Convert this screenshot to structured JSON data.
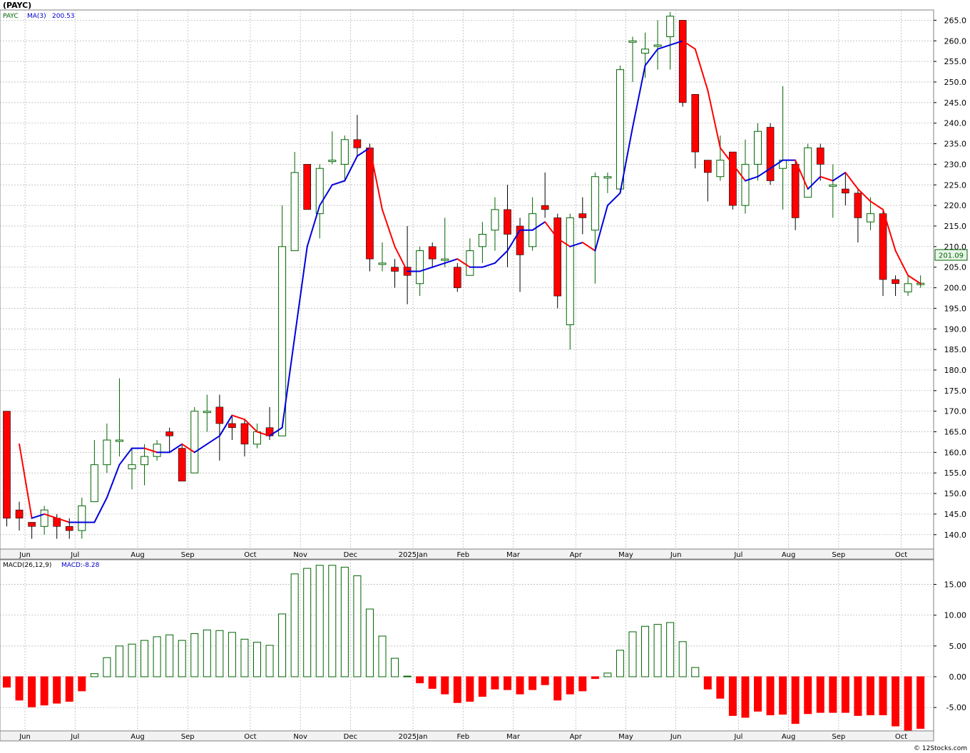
{
  "title": "(PAYC)",
  "credit": "© 12Stocks.com",
  "last_price_label": "201.09",
  "colors": {
    "up": "#006400",
    "down": "#ff0000",
    "ma_up": "#0000dd",
    "ma_down": "#ff0000",
    "grid": "#b0b0b0",
    "axis_bg": "#f2f2f2"
  },
  "legend": {
    "symbol": "PAYC",
    "ma_label": "MA(3)",
    "ma_value": "200.53",
    "macd_label": "MACD(26,12,9)",
    "macd_value": "MACD:-8.28"
  },
  "chart_data": {
    "type": "candlestick",
    "price_axis": {
      "ylim": [
        136.5,
        267.5
      ],
      "ticks": [
        140,
        145,
        150,
        155,
        160,
        165,
        170,
        175,
        180,
        185,
        190,
        195,
        200,
        205,
        210,
        215,
        220,
        225,
        230,
        235,
        240,
        245,
        250,
        255,
        260,
        265
      ]
    },
    "macd_axis": {
      "ylim": [
        -8.8,
        19.0
      ],
      "ticks": [
        "-5.00",
        "0.00",
        "5.00",
        "10.00",
        "15.00"
      ]
    },
    "month_labels": [
      "Jun",
      "Jul",
      "Aug",
      "Sep",
      "Oct",
      "Nov",
      "Dec",
      "2025Jan",
      "Feb",
      "Mar",
      "Apr",
      "May",
      "Jun",
      "Jul",
      "Aug",
      "Sep",
      "Oct"
    ],
    "month_label_week": [
      1,
      5,
      10,
      14,
      19,
      23,
      27,
      32,
      36,
      40,
      45,
      49,
      53,
      58,
      62,
      66,
      71
    ],
    "candles": [
      {
        "o": 170,
        "h": 170,
        "l": 142,
        "c": 144
      },
      {
        "o": 146,
        "h": 148,
        "l": 141,
        "c": 144
      },
      {
        "o": 143,
        "h": 143,
        "l": 139,
        "c": 142
      },
      {
        "o": 142,
        "h": 147,
        "l": 140,
        "c": 146
      },
      {
        "o": 144,
        "h": 145,
        "l": 139,
        "c": 142
      },
      {
        "o": 142,
        "h": 144,
        "l": 139,
        "c": 141
      },
      {
        "o": 141,
        "h": 149,
        "l": 139,
        "c": 147
      },
      {
        "o": 148,
        "h": 163,
        "l": 148,
        "c": 157
      },
      {
        "o": 157,
        "h": 167,
        "l": 155,
        "c": 163
      },
      {
        "o": 163,
        "h": 178,
        "l": 159,
        "c": 163
      },
      {
        "o": 156,
        "h": 161,
        "l": 151,
        "c": 157
      },
      {
        "o": 157,
        "h": 162,
        "l": 152,
        "c": 159
      },
      {
        "o": 159,
        "h": 163,
        "l": 158,
        "c": 162
      },
      {
        "o": 165,
        "h": 166,
        "l": 160,
        "c": 164
      },
      {
        "o": 161,
        "h": 162,
        "l": 153,
        "c": 153
      },
      {
        "o": 155,
        "h": 171,
        "l": 155,
        "c": 170
      },
      {
        "o": 170,
        "h": 174,
        "l": 165,
        "c": 170
      },
      {
        "o": 171,
        "h": 174,
        "l": 158,
        "c": 167
      },
      {
        "o": 167,
        "h": 169,
        "l": 163,
        "c": 166
      },
      {
        "o": 167,
        "h": 168,
        "l": 159,
        "c": 162
      },
      {
        "o": 162,
        "h": 167,
        "l": 161,
        "c": 165
      },
      {
        "o": 166,
        "h": 171,
        "l": 163,
        "c": 164
      },
      {
        "o": 164,
        "h": 220,
        "l": 164,
        "c": 210
      },
      {
        "o": 209,
        "h": 233,
        "l": 209,
        "c": 228
      },
      {
        "o": 230,
        "h": 230,
        "l": 219,
        "c": 219
      },
      {
        "o": 218,
        "h": 230,
        "l": 212,
        "c": 229
      },
      {
        "o": 231,
        "h": 238,
        "l": 230,
        "c": 231
      },
      {
        "o": 230,
        "h": 237,
        "l": 226,
        "c": 236
      },
      {
        "o": 236,
        "h": 242,
        "l": 232,
        "c": 234
      },
      {
        "o": 234,
        "h": 235,
        "l": 204,
        "c": 207
      },
      {
        "o": 206,
        "h": 211,
        "l": 204,
        "c": 206
      },
      {
        "o": 205,
        "h": 207,
        "l": 200,
        "c": 204
      },
      {
        "o": 205,
        "h": 215,
        "l": 196,
        "c": 203
      },
      {
        "o": 201,
        "h": 210,
        "l": 198,
        "c": 209
      },
      {
        "o": 210,
        "h": 211,
        "l": 205,
        "c": 207
      },
      {
        "o": 207,
        "h": 217,
        "l": 205,
        "c": 207
      },
      {
        "o": 205,
        "h": 206,
        "l": 199,
        "c": 200
      },
      {
        "o": 203,
        "h": 212,
        "l": 203,
        "c": 209
      },
      {
        "o": 210,
        "h": 216,
        "l": 206,
        "c": 213
      },
      {
        "o": 214,
        "h": 222,
        "l": 209,
        "c": 219
      },
      {
        "o": 219,
        "h": 225,
        "l": 205,
        "c": 213
      },
      {
        "o": 215,
        "h": 217,
        "l": 199,
        "c": 208
      },
      {
        "o": 210,
        "h": 222,
        "l": 209,
        "c": 218
      },
      {
        "o": 220,
        "h": 228,
        "l": 217,
        "c": 219
      },
      {
        "o": 217,
        "h": 218,
        "l": 195,
        "c": 198
      },
      {
        "o": 191,
        "h": 218,
        "l": 185,
        "c": 217
      },
      {
        "o": 218,
        "h": 222,
        "l": 213,
        "c": 217
      },
      {
        "o": 214,
        "h": 228,
        "l": 201,
        "c": 227
      },
      {
        "o": 227,
        "h": 228,
        "l": 223,
        "c": 227
      },
      {
        "o": 224,
        "h": 254,
        "l": 223,
        "c": 253
      },
      {
        "o": 260,
        "h": 261,
        "l": 250,
        "c": 260
      },
      {
        "o": 257,
        "h": 262,
        "l": 251,
        "c": 258
      },
      {
        "o": 259,
        "h": 265,
        "l": 253,
        "c": 259
      },
      {
        "o": 261,
        "h": 267,
        "l": 253,
        "c": 266
      },
      {
        "o": 265,
        "h": 265,
        "l": 244,
        "c": 245
      },
      {
        "o": 247,
        "h": 247,
        "l": 229,
        "c": 233
      },
      {
        "o": 231,
        "h": 231,
        "l": 221,
        "c": 228
      },
      {
        "o": 227,
        "h": 237,
        "l": 226,
        "c": 231
      },
      {
        "o": 233,
        "h": 233,
        "l": 219,
        "c": 220
      },
      {
        "o": 220,
        "h": 236,
        "l": 218,
        "c": 230
      },
      {
        "o": 230,
        "h": 240,
        "l": 226,
        "c": 238
      },
      {
        "o": 239,
        "h": 240,
        "l": 225,
        "c": 226
      },
      {
        "o": 229,
        "h": 249,
        "l": 219,
        "c": 231
      },
      {
        "o": 230,
        "h": 231,
        "l": 214,
        "c": 217
      },
      {
        "o": 222,
        "h": 235,
        "l": 222,
        "c": 234
      },
      {
        "o": 234,
        "h": 235,
        "l": 226,
        "c": 230
      },
      {
        "o": 225,
        "h": 230,
        "l": 217,
        "c": 225
      },
      {
        "o": 224,
        "h": 228,
        "l": 220,
        "c": 223
      },
      {
        "o": 223,
        "h": 224,
        "l": 211,
        "c": 217
      },
      {
        "o": 216,
        "h": 222,
        "l": 214,
        "c": 218
      },
      {
        "o": 218,
        "h": 219,
        "l": 198,
        "c": 202
      },
      {
        "o": 202,
        "h": 203,
        "l": 198,
        "c": 201
      },
      {
        "o": 199,
        "h": 203,
        "l": 198,
        "c": 201
      },
      {
        "o": 201,
        "h": 203,
        "l": 200,
        "c": 201.1
      }
    ],
    "ma3": [
      null,
      162,
      144,
      145,
      144,
      143,
      143,
      143,
      149,
      157,
      161,
      161,
      160,
      160,
      162,
      160,
      162,
      164,
      169,
      168,
      165,
      164,
      166,
      188,
      210,
      220,
      225,
      226,
      232,
      234,
      219,
      210,
      204,
      204,
      205,
      206,
      207,
      205,
      205,
      206,
      209,
      214,
      214,
      216,
      212,
      210,
      211,
      209,
      220,
      223,
      239,
      254,
      258,
      259,
      260,
      258,
      248,
      234,
      230,
      226,
      227,
      229,
      231,
      231,
      224,
      227,
      226,
      228,
      224,
      221,
      219,
      209,
      203,
      201
    ],
    "macd_hist": [
      -1.7,
      -3.8,
      -4.9,
      -4.6,
      -4.3,
      -4.0,
      -2.3,
      0.5,
      3.1,
      5.0,
      5.3,
      5.9,
      6.5,
      6.8,
      5.9,
      7.0,
      7.6,
      7.5,
      7.2,
      6.1,
      5.6,
      5.1,
      10.2,
      16.7,
      17.6,
      18.1,
      18.1,
      17.8,
      16.4,
      11.0,
      6.6,
      3.0,
      0.1,
      -1.0,
      -1.9,
      -2.8,
      -4.2,
      -4.0,
      -3.2,
      -2.0,
      -2.1,
      -2.8,
      -2.1,
      -1.3,
      -3.8,
      -2.8,
      -2.3,
      -0.3,
      0.6,
      4.3,
      7.3,
      8.2,
      8.5,
      8.8,
      5.7,
      1.5,
      -2.0,
      -3.5,
      -6.3,
      -6.6,
      -5.6,
      -6.2,
      -6.1,
      -7.6,
      -6.0,
      -5.8,
      -5.8,
      -5.8,
      -6.3,
      -6.2,
      -6.2,
      -8.0,
      -8.8,
      -8.4
    ]
  }
}
